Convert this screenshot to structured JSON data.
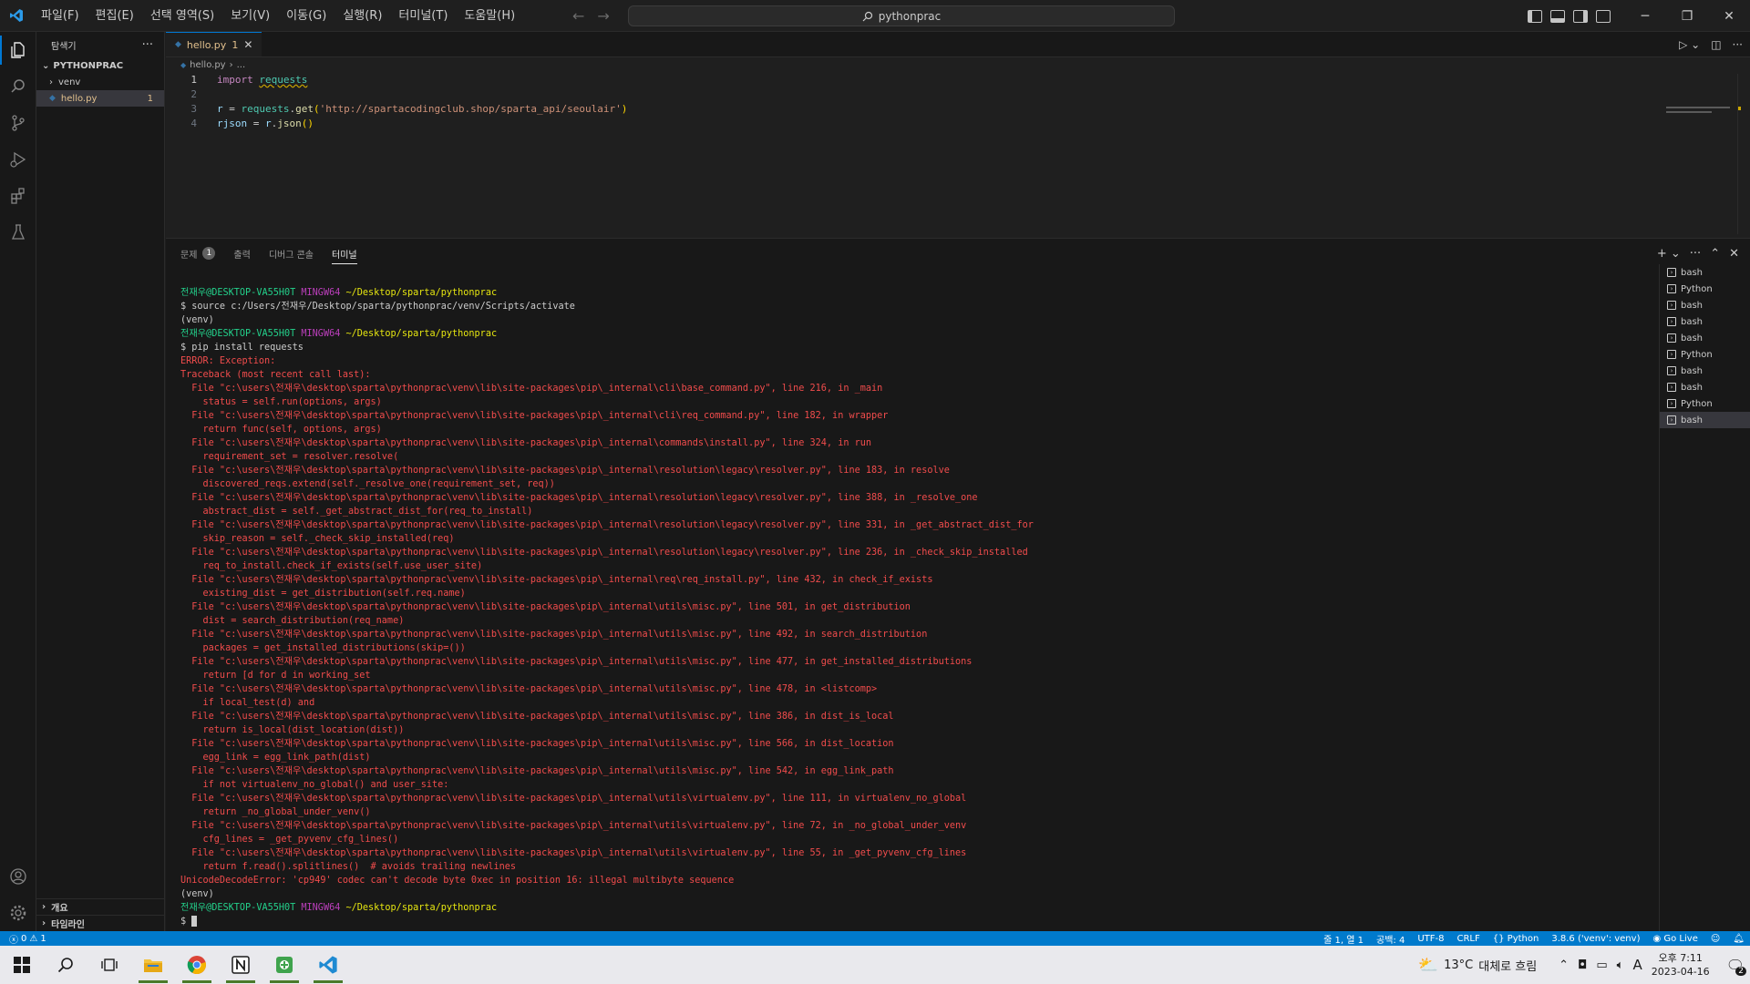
{
  "titlebar": {
    "menus": [
      "파일(F)",
      "편집(E)",
      "선택 영역(S)",
      "보기(V)",
      "이동(G)",
      "실행(R)",
      "터미널(T)",
      "도움말(H)"
    ],
    "search_text": "pythonprac"
  },
  "sidebar": {
    "title": "탐색기",
    "folder": "PYTHONPRAC",
    "items": [
      {
        "label": "venv",
        "badge": ""
      },
      {
        "label": "hello.py",
        "badge": "1"
      }
    ],
    "bottom_sections": [
      "개요",
      "타임라인"
    ]
  },
  "editor": {
    "tab_label": "hello.py",
    "tab_badge": "1",
    "breadcrumb_file": "hello.py",
    "breadcrumb_rest": "...",
    "line_numbers": [
      "1",
      "2",
      "3",
      "4"
    ],
    "code": {
      "l1_kw": "import",
      "l1_mod": "requests",
      "l3_var": "r",
      "l3_eq": " = ",
      "l3_mod": "requests",
      "l3_dot": ".",
      "l3_fn": "get",
      "l3_open": "(",
      "l3_str": "'http://spartacodingclub.shop/sparta_api/seoulair'",
      "l3_close": ")",
      "l4_var": "rjson",
      "l4_eq": " = ",
      "l4_var2": "r",
      "l4_dot": ".",
      "l4_fn": "json",
      "l4_paren": "()"
    }
  },
  "panel": {
    "tabs": [
      {
        "label": "문제",
        "badge": "1"
      },
      {
        "label": "출력",
        "badge": ""
      },
      {
        "label": "디버그 콘솔",
        "badge": ""
      },
      {
        "label": "터미널",
        "badge": ""
      }
    ],
    "prompt": {
      "user": "전재우@DESKTOP-VA55H0T",
      "host": "MINGW64",
      "path": "~/Desktop/sparta/pythonprac"
    },
    "terminal_lines": {
      "cmd1": "$ source c:/Users/전재우/Desktop/sparta/pythonprac/venv/Scripts/activate",
      "venv": "(venv)",
      "cmd2": "$ pip install requests",
      "errors": [
        "ERROR: Exception:",
        "Traceback (most recent call last):",
        "  File \"c:\\users\\전재우\\desktop\\sparta\\pythonprac\\venv\\lib\\site-packages\\pip\\_internal\\cli\\base_command.py\", line 216, in _main",
        "    status = self.run(options, args)",
        "  File \"c:\\users\\전재우\\desktop\\sparta\\pythonprac\\venv\\lib\\site-packages\\pip\\_internal\\cli\\req_command.py\", line 182, in wrapper",
        "    return func(self, options, args)",
        "  File \"c:\\users\\전재우\\desktop\\sparta\\pythonprac\\venv\\lib\\site-packages\\pip\\_internal\\commands\\install.py\", line 324, in run",
        "    requirement_set = resolver.resolve(",
        "  File \"c:\\users\\전재우\\desktop\\sparta\\pythonprac\\venv\\lib\\site-packages\\pip\\_internal\\resolution\\legacy\\resolver.py\", line 183, in resolve",
        "    discovered_reqs.extend(self._resolve_one(requirement_set, req))",
        "  File \"c:\\users\\전재우\\desktop\\sparta\\pythonprac\\venv\\lib\\site-packages\\pip\\_internal\\resolution\\legacy\\resolver.py\", line 388, in _resolve_one",
        "    abstract_dist = self._get_abstract_dist_for(req_to_install)",
        "  File \"c:\\users\\전재우\\desktop\\sparta\\pythonprac\\venv\\lib\\site-packages\\pip\\_internal\\resolution\\legacy\\resolver.py\", line 331, in _get_abstract_dist_for",
        "    skip_reason = self._check_skip_installed(req)",
        "  File \"c:\\users\\전재우\\desktop\\sparta\\pythonprac\\venv\\lib\\site-packages\\pip\\_internal\\resolution\\legacy\\resolver.py\", line 236, in _check_skip_installed",
        "    req_to_install.check_if_exists(self.use_user_site)",
        "  File \"c:\\users\\전재우\\desktop\\sparta\\pythonprac\\venv\\lib\\site-packages\\pip\\_internal\\req\\req_install.py\", line 432, in check_if_exists",
        "    existing_dist = get_distribution(self.req.name)",
        "  File \"c:\\users\\전재우\\desktop\\sparta\\pythonprac\\venv\\lib\\site-packages\\pip\\_internal\\utils\\misc.py\", line 501, in get_distribution",
        "    dist = search_distribution(req_name)",
        "  File \"c:\\users\\전재우\\desktop\\sparta\\pythonprac\\venv\\lib\\site-packages\\pip\\_internal\\utils\\misc.py\", line 492, in search_distribution",
        "    packages = get_installed_distributions(skip=())",
        "  File \"c:\\users\\전재우\\desktop\\sparta\\pythonprac\\venv\\lib\\site-packages\\pip\\_internal\\utils\\misc.py\", line 477, in get_installed_distributions",
        "    return [d for d in working_set",
        "  File \"c:\\users\\전재우\\desktop\\sparta\\pythonprac\\venv\\lib\\site-packages\\pip\\_internal\\utils\\misc.py\", line 478, in <listcomp>",
        "    if local_test(d) and",
        "  File \"c:\\users\\전재우\\desktop\\sparta\\pythonprac\\venv\\lib\\site-packages\\pip\\_internal\\utils\\misc.py\", line 386, in dist_is_local",
        "    return is_local(dist_location(dist))",
        "  File \"c:\\users\\전재우\\desktop\\sparta\\pythonprac\\venv\\lib\\site-packages\\pip\\_internal\\utils\\misc.py\", line 566, in dist_location",
        "    egg_link = egg_link_path(dist)",
        "  File \"c:\\users\\전재우\\desktop\\sparta\\pythonprac\\venv\\lib\\site-packages\\pip\\_internal\\utils\\misc.py\", line 542, in egg_link_path",
        "    if not virtualenv_no_global() and user_site:",
        "  File \"c:\\users\\전재우\\desktop\\sparta\\pythonprac\\venv\\lib\\site-packages\\pip\\_internal\\utils\\virtualenv.py\", line 111, in virtualenv_no_global",
        "    return _no_global_under_venv()",
        "  File \"c:\\users\\전재우\\desktop\\sparta\\pythonprac\\venv\\lib\\site-packages\\pip\\_internal\\utils\\virtualenv.py\", line 72, in _no_global_under_venv",
        "    cfg_lines = _get_pyvenv_cfg_lines()",
        "  File \"c:\\users\\전재우\\desktop\\sparta\\pythonprac\\venv\\lib\\site-packages\\pip\\_internal\\utils\\virtualenv.py\", line 55, in _get_pyvenv_cfg_lines",
        "    return f.read().splitlines()  # avoids trailing newlines",
        "UnicodeDecodeError: 'cp949' codec can't decode byte 0xec in position 16: illegal multibyte sequence"
      ],
      "final_prompt": "$ "
    },
    "terminal_instances": [
      "bash",
      "Python",
      "bash",
      "bash",
      "bash",
      "Python",
      "bash",
      "bash",
      "Python",
      "bash"
    ]
  },
  "statusbar": {
    "errors": "0",
    "warnings": "1",
    "position": "줄 1, 열 1",
    "spaces": "공백: 4",
    "encoding": "UTF-8",
    "eol": "CRLF",
    "language": "Python",
    "interpreter": "3.8.6 ('venv': venv)",
    "go_live": "Go Live"
  },
  "taskbar": {
    "weather_temp": "13°C",
    "weather_desc": "대체로 흐림",
    "ime": "A",
    "time": "오후 7:11",
    "date": "2023-04-16",
    "notification_count": "2"
  },
  "colors": {
    "accent": "#0078d4",
    "statusbar": "#007acc",
    "error_text": "#f14c4c",
    "prompt_user": "#23d18b",
    "prompt_host": "#bc3fbc",
    "prompt_path": "#e5e510"
  }
}
